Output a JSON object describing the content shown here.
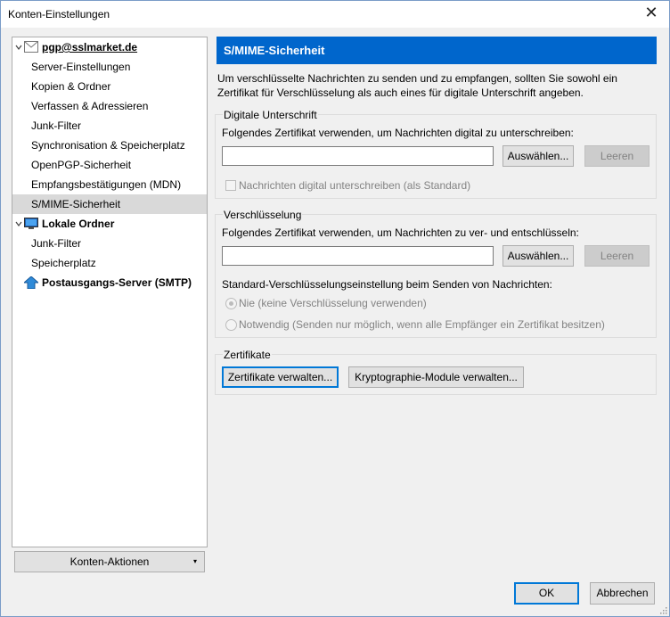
{
  "window": {
    "title": "Konten-Einstellungen",
    "close": "✕"
  },
  "tree": {
    "account_name": "pgp@sslmarket.de",
    "account_items": [
      "Server-Einstellungen",
      "Kopien & Ordner",
      "Verfassen & Adressieren",
      "Junk-Filter",
      "Synchronisation & Speicherplatz",
      "OpenPGP-Sicherheit",
      "Empfangsbestätigungen (MDN)",
      "S/MIME-Sicherheit"
    ],
    "local_name": "Lokale Ordner",
    "local_items": [
      "Junk-Filter",
      "Speicherplatz"
    ],
    "smtp_name": "Postausgangs-Server (SMTP)"
  },
  "account_actions": {
    "label": "Konten-Aktionen",
    "arrow": "▾"
  },
  "panel": {
    "title": "S/MIME-Sicherheit",
    "intro": "Um verschlüsselte Nachrichten zu senden und zu empfangen, sollten Sie sowohl ein Zertifikat für Verschlüsselung als auch eines für digitale Unterschrift angeben."
  },
  "signature": {
    "group_title": "Digitale Unterschrift",
    "label": "Folgendes Zertifikat verwenden, um Nachrichten digital zu unterschreiben:",
    "value": "",
    "select_label": "Auswählen...",
    "clear_label": "Leeren",
    "checkbox_label": "Nachrichten digital unterschreiben (als Standard)"
  },
  "encryption": {
    "group_title": "Verschlüsselung",
    "label": "Folgendes Zertifikat verwenden, um Nachrichten zu ver- und entschlüsseln:",
    "value": "",
    "select_label": "Auswählen...",
    "clear_label": "Leeren",
    "default_label": "Standard-Verschlüsselungseinstellung beim Senden von Nachrichten:",
    "option_never": "Nie (keine Verschlüsselung verwenden)",
    "option_required": "Notwendig (Senden nur möglich, wenn alle Empfänger ein Zertifikat besitzen)"
  },
  "certificates": {
    "group_title": "Zertifikate",
    "manage_label": "Zertifikate verwalten...",
    "modules_label": "Kryptographie-Module verwalten..."
  },
  "footer": {
    "ok_label": "OK",
    "cancel_label": "Abbrechen"
  }
}
